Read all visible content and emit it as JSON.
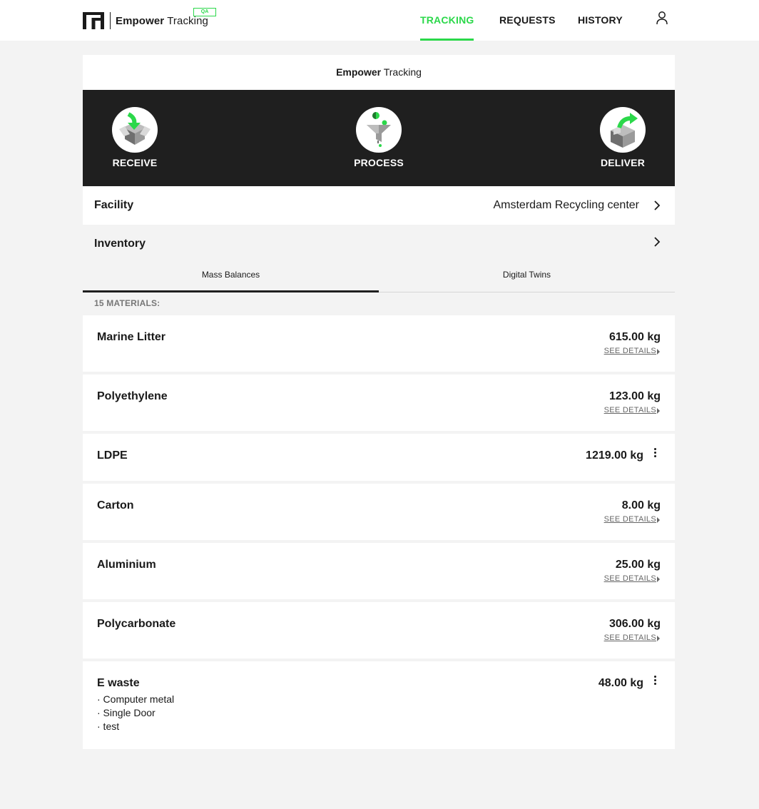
{
  "app": {
    "brand_bold": "Empower",
    "brand_light": "Tracking",
    "env_badge": "QA",
    "accent_color": "#2bd84a"
  },
  "nav": {
    "items": [
      {
        "label": "TRACKING",
        "active": true
      },
      {
        "label": "REQUESTS",
        "active": false
      },
      {
        "label": "HISTORY",
        "active": false
      }
    ],
    "user_icon": "user-icon"
  },
  "card": {
    "header_bold": "Empower",
    "header_light": "Tracking"
  },
  "steps": [
    {
      "label": "RECEIVE",
      "icon": "receive-box-icon"
    },
    {
      "label": "PROCESS",
      "icon": "process-funnel-icon"
    },
    {
      "label": "DELIVER",
      "icon": "deliver-box-icon"
    }
  ],
  "facility": {
    "label": "Facility",
    "value": "Amsterdam Recycling center"
  },
  "inventory": {
    "label": "Inventory"
  },
  "tabs": [
    {
      "label": "Mass Balances",
      "active": true
    },
    {
      "label": "Digital Twins",
      "active": false
    }
  ],
  "materials_count": "15 MATERIALS:",
  "materials": [
    {
      "name": "Marine Litter",
      "qty": "615.00 kg",
      "details": "SEE DETAILS"
    },
    {
      "name": "Polyethylene",
      "qty": "123.00 kg",
      "details": "SEE DETAILS"
    },
    {
      "name": "LDPE",
      "qty": "1219.00 kg"
    },
    {
      "name": "Carton",
      "qty": "8.00 kg",
      "details": "SEE DETAILS"
    },
    {
      "name": "Aluminium",
      "qty": "25.00 kg",
      "details": "SEE DETAILS"
    },
    {
      "name": "Polycarbonate",
      "qty": "306.00 kg",
      "details": "SEE DETAILS"
    },
    {
      "name": "E waste",
      "qty": "48.00 kg",
      "sub_items": [
        "· Computer metal",
        "· Single Door",
        "· test"
      ]
    }
  ]
}
